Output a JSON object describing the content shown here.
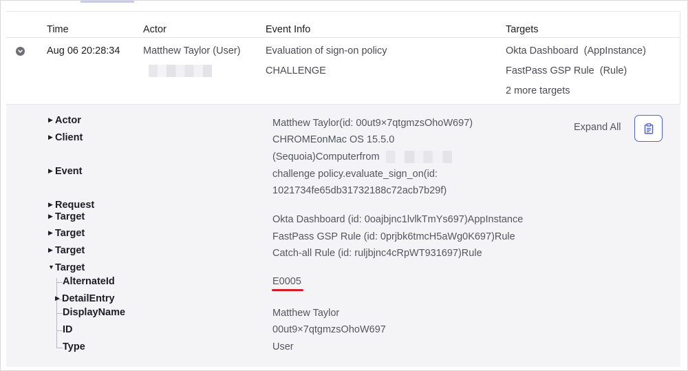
{
  "table": {
    "headers": {
      "time": "Time",
      "actor": "Actor",
      "event_info": "Event Info",
      "targets": "Targets"
    },
    "row": {
      "time": "Aug 06 20:28:34",
      "actor_name": "Matthew Taylor",
      "actor_type": "(User)",
      "event_title": "Evaluation of sign-on policy",
      "event_result": "CHALLENGE",
      "target_1_name": "Okta Dashboard",
      "target_1_type": "(AppInstance)",
      "target_2_name": "FastPass GSP Rule",
      "target_2_type": "(Rule)",
      "more_targets": "2 more targets"
    }
  },
  "detail": {
    "expand_all_label": "Expand All",
    "tree": {
      "actor": "Actor",
      "client": "Client",
      "event": "Event",
      "request": "Request",
      "target_1": "Target",
      "target_2": "Target",
      "target_3": "Target",
      "target_4": "Target",
      "alternate_id": "AlternateId",
      "detail_entry": "DetailEntry",
      "display_name": "DisplayName",
      "id": "ID",
      "type": "Type"
    },
    "values": {
      "actor": "Matthew Taylor(id: 00ut9×7qtgmzsOhoW697)",
      "client_line_1": "CHROMEonMac OS 15.5.0",
      "client_line_2": "(Sequoia)Computerfrom",
      "event_line_1": "challenge policy.evaluate_sign_on(id:",
      "event_line_2": "1021734fe65db31732188c72acb7b29f)",
      "target_1": "Okta Dashboard (id: 0oajbjnc1lvlkTmYs697)AppInstance",
      "target_2": "FastPass GSP Rule (id: 0prjbk6tmcH5aWg0K697)Rule",
      "target_3": "Catch-all Rule (id: ruljbjnc4cRpWT931697)Rule",
      "alternate_id": "E0005",
      "display_name": "Matthew Taylor",
      "id": "00ut9×7qtgmzsOhoW697",
      "type": "User"
    }
  },
  "icons": {
    "row_toggle": "chevron-down-circle-icon",
    "copy": "clipboard-icon",
    "collapsed": "triangle-right-icon",
    "expanded": "triangle-down-icon"
  },
  "colors": {
    "accent": "#4f62d6",
    "highlight_underline": "#d41c25",
    "detail_background": "#f4f4f6"
  }
}
